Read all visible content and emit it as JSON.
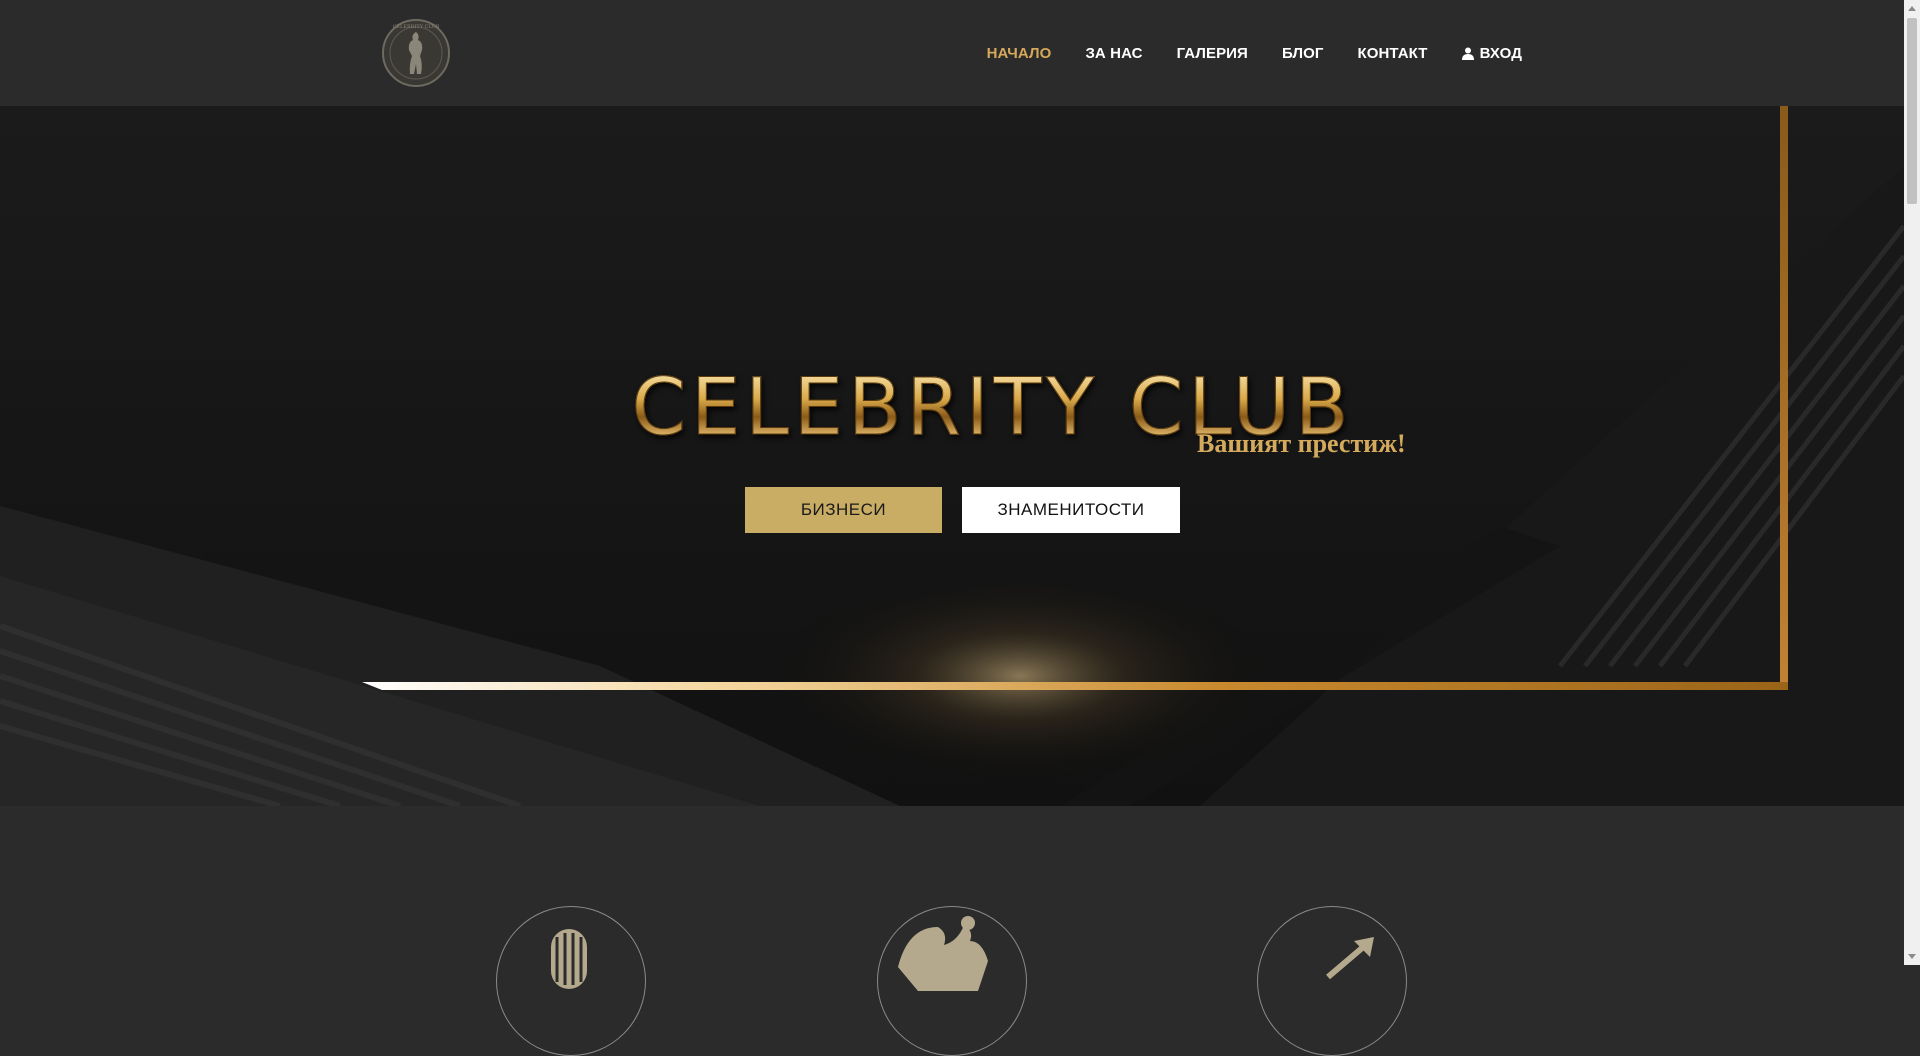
{
  "header": {
    "logo_alt": "CELEBRITY CLUB",
    "nav": [
      {
        "label": "НАЧАЛО",
        "active": true
      },
      {
        "label": "ЗА НАС",
        "active": false
      },
      {
        "label": "ГАЛЕРИЯ",
        "active": false
      },
      {
        "label": "БЛОГ",
        "active": false
      },
      {
        "label": "КОНТАКТ",
        "active": false
      },
      {
        "label": "ВХОД",
        "active": false,
        "icon": "user-icon"
      }
    ]
  },
  "hero": {
    "title": "CELEBRITY CLUB",
    "subtitle": "Вашият престиж!",
    "buttons": {
      "business": "БИЗНЕСИ",
      "celebrities": "ЗНАМЕНИТОСТИ"
    }
  },
  "features": {
    "icons": [
      "microphone-icon",
      "dancers-icon",
      "growth-arrow-icon"
    ]
  },
  "colors": {
    "accent_gold": "#d6a85a",
    "button_gold": "#c9ad64",
    "header_bg": "#2b2b2b",
    "hero_bg": "#1b1b1b"
  }
}
